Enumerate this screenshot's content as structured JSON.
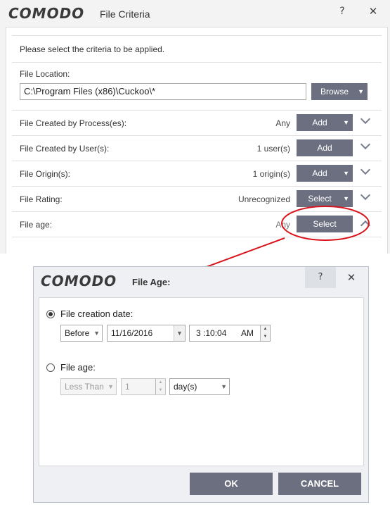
{
  "main_window": {
    "logo": "COMODO",
    "title": "File Criteria",
    "help_label": "?",
    "close_label": "✕",
    "instruction": "Please select the criteria to be applied.",
    "file_location": {
      "label": "File Location:",
      "value": "C:\\Program Files (x86)\\Cuckoo\\*",
      "browse_label": "Browse"
    },
    "rows": [
      {
        "label": "File Created by Process(es):",
        "value": "Any",
        "button": "Add"
      },
      {
        "label": "File Created by User(s):",
        "value": "1 user(s)",
        "button": "Add"
      },
      {
        "label": "File Origin(s):",
        "value": "1 origin(s)",
        "button": "Add"
      },
      {
        "label": "File Rating:",
        "value": "Unrecognized",
        "button": "Select"
      },
      {
        "label": "File age:",
        "value": "Any",
        "button": "Select"
      }
    ]
  },
  "dialog": {
    "logo": "COMODO",
    "title": "File Age:",
    "help_label": "?",
    "close_label": "✕",
    "creation_date": {
      "label": "File creation date:",
      "selected": true,
      "comparator": "Before",
      "date": "11/16/2016",
      "time": "3 :10:04",
      "ampm": "AM"
    },
    "file_age": {
      "label": "File age:",
      "selected": false,
      "comparator": "Less Than",
      "amount": "1",
      "unit": "day(s)"
    },
    "ok_label": "OK",
    "cancel_label": "CANCEL"
  },
  "colors": {
    "button_bg": "#6c6f7f",
    "annotation_red": "#d9141c"
  }
}
